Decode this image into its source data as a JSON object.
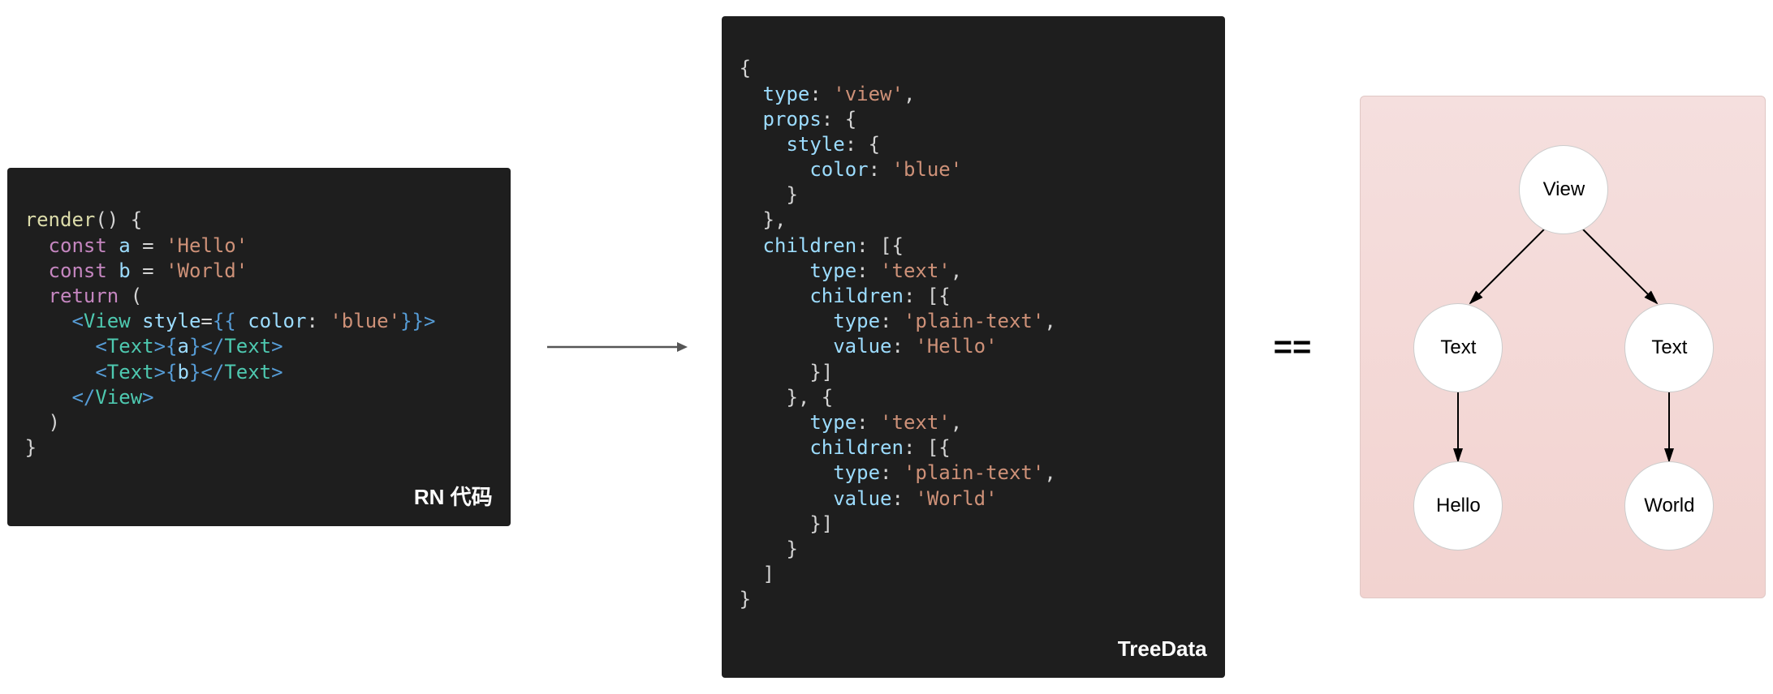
{
  "left_label": "RN 代码",
  "middle_label": "TreeData",
  "equals": "==",
  "left_code": {
    "l1_fn": "render",
    "l1_rest": "() {",
    "l2_kw": "const",
    "l2_var": "a",
    "l2_eq": " = ",
    "l2_str": "'Hello'",
    "l3_kw": "const",
    "l3_var": "b",
    "l3_eq": " = ",
    "l3_str": "'World'",
    "l4_kw": "return",
    "l4_rest": " (",
    "l5_o": "<",
    "l5_tag": "View",
    "l5_sp": " ",
    "l5_attr": "style",
    "l5_eq": "=",
    "l5_b1": "{{ ",
    "l5_key": "color",
    "l5_colon": ": ",
    "l5_str": "'blue'",
    "l5_b2": "}}",
    "l5_c": ">",
    "l6_o": "<",
    "l6_tag": "Text",
    "l6_c": ">",
    "l6_b1": "{",
    "l6_var": "a",
    "l6_b2": "}",
    "l6_o2": "</",
    "l6_tag2": "Text",
    "l6_c2": ">",
    "l7_o": "<",
    "l7_tag": "Text",
    "l7_c": ">",
    "l7_b1": "{",
    "l7_var": "b",
    "l7_b2": "}",
    "l7_o2": "</",
    "l7_tag2": "Text",
    "l7_c2": ">",
    "l8_o": "</",
    "l8_tag": "View",
    "l8_c": ">",
    "l9": ")",
    "l10": "}"
  },
  "mid_code": {
    "m1": "{",
    "m2_k": "type",
    "m2_c": ": ",
    "m2_v": "'view'",
    "m2_e": ",",
    "m3_k": "props",
    "m3_c": ": {",
    "m4_k": "style",
    "m4_c": ": {",
    "m5_k": "color",
    "m5_c": ": ",
    "m5_v": "'blue'",
    "m6": "}",
    "m7": "},",
    "m8_k": "children",
    "m8_c": ": [{",
    "m9_k": "type",
    "m9_c": ": ",
    "m9_v": "'text'",
    "m9_e": ",",
    "m10_k": "children",
    "m10_c": ": [{",
    "m11_k": "type",
    "m11_c": ": ",
    "m11_v": "'plain-text'",
    "m11_e": ",",
    "m12_k": "value",
    "m12_c": ": ",
    "m12_v": "'Hello'",
    "m13": "}]",
    "m14": "}, {",
    "m15_k": "type",
    "m15_c": ": ",
    "m15_v": "'text'",
    "m15_e": ",",
    "m16_k": "children",
    "m16_c": ": [{",
    "m17_k": "type",
    "m17_c": ": ",
    "m17_v": "'plain-text'",
    "m17_e": ",",
    "m18_k": "value",
    "m18_c": ": ",
    "m18_v": "'World'",
    "m19": "}]",
    "m20": "}",
    "m21": "]",
    "m22": "}"
  },
  "tree": {
    "view": "View",
    "text1": "Text",
    "text2": "Text",
    "hello": "Hello",
    "world": "World"
  }
}
